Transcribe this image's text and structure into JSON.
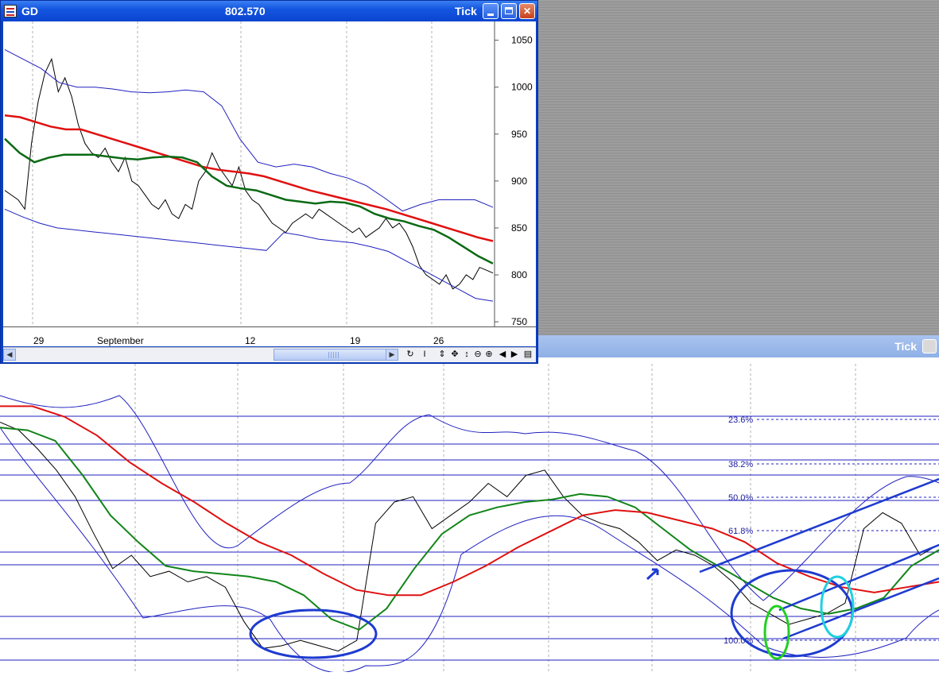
{
  "window": {
    "symbol": "GD",
    "price": "802.570",
    "mode": "Tick"
  },
  "background_window": {
    "mode": "Tick"
  },
  "date_axis": [
    "29",
    "September",
    "12",
    "19",
    "26"
  ],
  "chart_data": [
    {
      "type": "line",
      "y_ticks": [
        "1050",
        "1000",
        "950",
        "900",
        "850",
        "800",
        "750"
      ],
      "ylim": [
        745,
        1070
      ],
      "grid": "vertical dashed",
      "series": [
        {
          "values": [
            890,
            885,
            880,
            870,
            940,
            985,
            1015,
            1030,
            995,
            1010,
            990,
            960,
            940,
            930,
            925,
            935,
            920,
            910,
            925,
            900,
            895,
            885,
            875,
            870,
            880,
            865,
            860,
            875,
            870,
            900,
            910,
            930,
            915,
            905,
            895,
            915,
            890,
            880,
            875,
            865,
            855,
            850,
            845,
            855,
            860,
            865,
            860,
            870,
            865,
            860,
            855,
            850,
            845,
            850,
            840,
            845,
            850,
            860,
            850,
            855,
            845,
            830,
            810,
            800,
            795,
            790,
            800,
            785,
            790,
            800,
            795,
            808,
            805,
            802
          ]
        },
        {
          "values": [
            970,
            968,
            963,
            958,
            955,
            955,
            950,
            945,
            940,
            935,
            930,
            925,
            920,
            915,
            912,
            910,
            908,
            905,
            900,
            895,
            890,
            886,
            882,
            878,
            874,
            870,
            865,
            860,
            855,
            850,
            845,
            840,
            836
          ]
        },
        {
          "values": [
            945,
            930,
            920,
            925,
            928,
            928,
            928,
            926,
            924,
            923,
            925,
            926,
            925,
            920,
            905,
            895,
            892,
            890,
            885,
            880,
            878,
            876,
            878,
            877,
            873,
            865,
            860,
            857,
            852,
            848,
            840,
            830,
            820,
            812
          ]
        },
        {
          "values": [
            1040,
            1030,
            1020,
            1005,
            1000,
            1000,
            998,
            995,
            994,
            995,
            997,
            995,
            980,
            945,
            920,
            915,
            918,
            915,
            908,
            903,
            895,
            882,
            868,
            875,
            880,
            880,
            880,
            872
          ]
        },
        {
          "values": [
            870,
            862,
            855,
            850,
            848,
            846,
            844,
            842,
            840,
            838,
            836,
            834,
            832,
            830,
            828,
            826,
            845,
            842,
            838,
            836,
            834,
            830,
            825,
            815,
            805,
            795,
            785,
            775,
            772
          ]
        }
      ]
    },
    {
      "type": "line",
      "fib_labels": [
        "23.6%",
        "38.2%",
        "50.0%",
        "61.8%",
        "100.0%"
      ],
      "grid": "vertical dashed",
      "series": [
        {
          "values": [
            0.9,
            0.87,
            0.8,
            0.72,
            0.62,
            0.48,
            0.35,
            0.4,
            0.32,
            0.34,
            0.3,
            0.32,
            0.28,
            0.15,
            0.05,
            0.06,
            0.08,
            0.06,
            0.04,
            0.08,
            0.52,
            0.6,
            0.62,
            0.5,
            0.55,
            0.6,
            0.67,
            0.62,
            0.7,
            0.72,
            0.62,
            0.55,
            0.52,
            0.5,
            0.45,
            0.38,
            0.42,
            0.4,
            0.36,
            0.3,
            0.22,
            0.18,
            0.14,
            0.16,
            0.18,
            0.22,
            0.5,
            0.56,
            0.52,
            0.4,
            0.44
          ]
        },
        {
          "values": [
            0.88,
            0.87,
            0.83,
            0.7,
            0.55,
            0.45,
            0.36,
            0.34,
            0.33,
            0.32,
            0.3,
            0.25,
            0.16,
            0.12,
            0.2,
            0.35,
            0.48,
            0.55,
            0.58,
            0.6,
            0.61,
            0.63,
            0.62,
            0.58,
            0.5,
            0.42,
            0.36,
            0.3,
            0.24,
            0.2,
            0.18,
            0.2,
            0.24,
            0.36,
            0.42
          ]
        },
        {
          "values": [
            0.96,
            0.96,
            0.92,
            0.85,
            0.75,
            0.67,
            0.6,
            0.52,
            0.45,
            0.4,
            0.33,
            0.27,
            0.25,
            0.25,
            0.3,
            0.36,
            0.43,
            0.49,
            0.55,
            0.57,
            0.56,
            0.53,
            0.5,
            0.45,
            0.37,
            0.32,
            0.28,
            0.26,
            0.28,
            0.3
          ]
        }
      ]
    }
  ]
}
